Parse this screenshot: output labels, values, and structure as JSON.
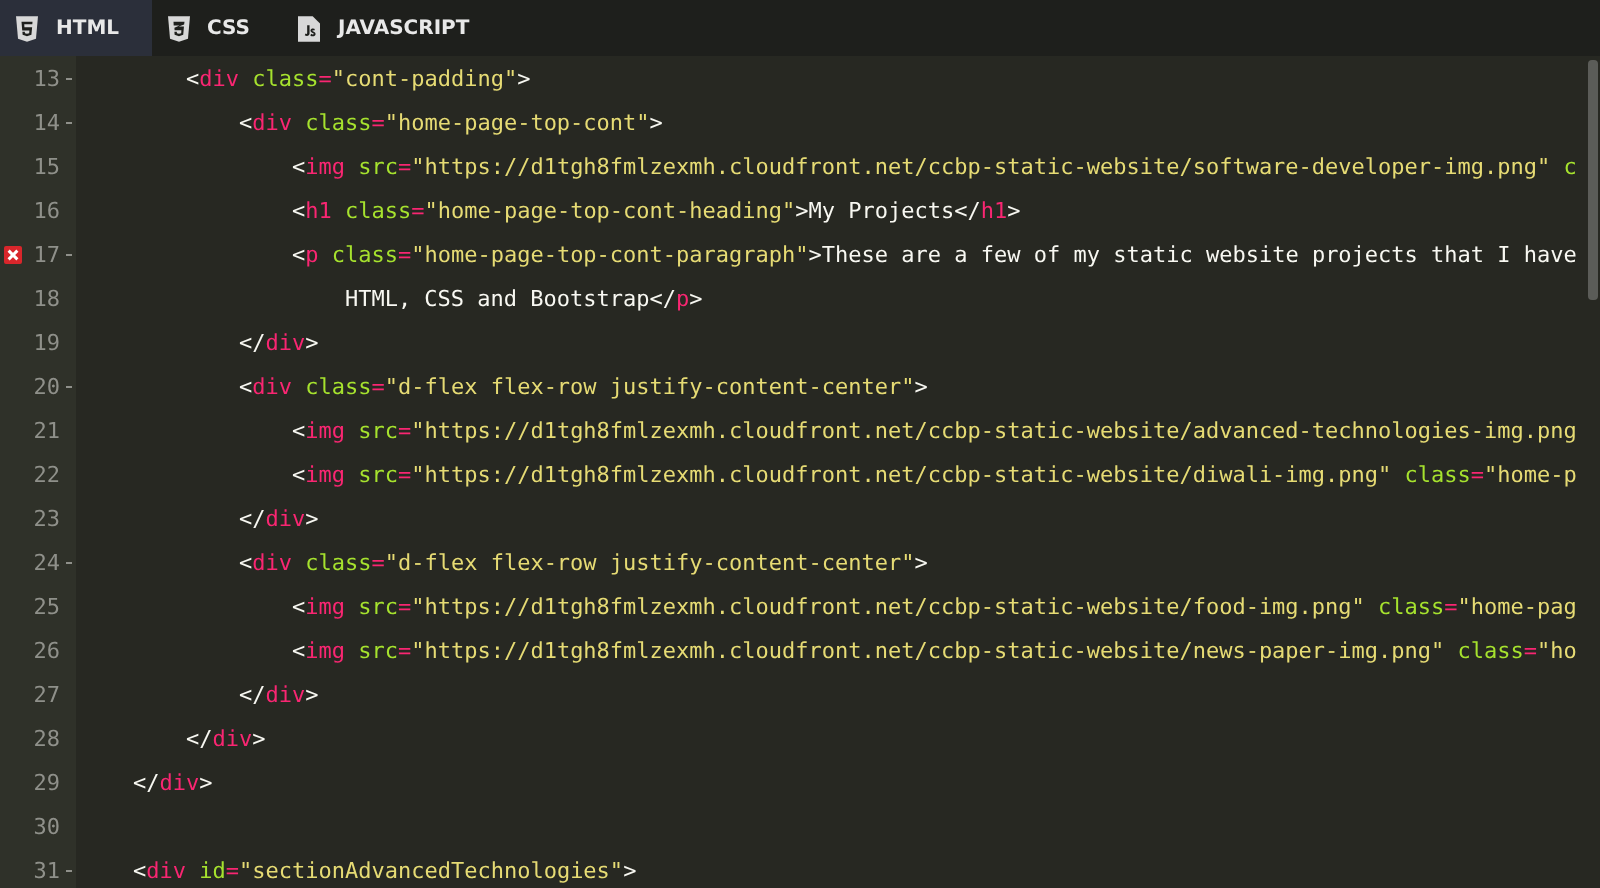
{
  "tabs": [
    {
      "label": "HTML",
      "selected": true
    },
    {
      "label": "CSS",
      "selected": false
    },
    {
      "label": "JAVASCRIPT",
      "selected": false
    }
  ],
  "lines": [
    {
      "number": "13",
      "fold": true,
      "error": false,
      "tokens": [
        {
          "kind": "punct",
          "text": "        <"
        },
        {
          "kind": "tag",
          "text": "div"
        },
        {
          "kind": "attr",
          "text": " class"
        },
        {
          "kind": "op",
          "text": "="
        },
        {
          "kind": "str",
          "text": "\"cont-padding\""
        },
        {
          "kind": "punct",
          "text": ">"
        }
      ]
    },
    {
      "number": "14",
      "fold": true,
      "error": false,
      "tokens": [
        {
          "kind": "punct",
          "text": "            <"
        },
        {
          "kind": "tag",
          "text": "div"
        },
        {
          "kind": "attr",
          "text": " class"
        },
        {
          "kind": "op",
          "text": "="
        },
        {
          "kind": "str",
          "text": "\"home-page-top-cont\""
        },
        {
          "kind": "punct",
          "text": ">"
        }
      ]
    },
    {
      "number": "15",
      "fold": false,
      "error": false,
      "tokens": [
        {
          "kind": "punct",
          "text": "                <"
        },
        {
          "kind": "tag",
          "text": "img"
        },
        {
          "kind": "attr",
          "text": " src"
        },
        {
          "kind": "op",
          "text": "="
        },
        {
          "kind": "str",
          "text": "\"https://d1tgh8fmlzexmh.cloudfront.net/ccbp-static-website/software-developer-img.png\""
        },
        {
          "kind": "attr",
          "text": " c"
        }
      ]
    },
    {
      "number": "16",
      "fold": false,
      "error": false,
      "tokens": [
        {
          "kind": "punct",
          "text": "                <"
        },
        {
          "kind": "tag",
          "text": "h1"
        },
        {
          "kind": "attr",
          "text": " class"
        },
        {
          "kind": "op",
          "text": "="
        },
        {
          "kind": "str",
          "text": "\"home-page-top-cont-heading\""
        },
        {
          "kind": "punct",
          "text": ">"
        },
        {
          "kind": "text",
          "text": "My Projects"
        },
        {
          "kind": "punct",
          "text": "</"
        },
        {
          "kind": "tag",
          "text": "h1"
        },
        {
          "kind": "punct",
          "text": ">"
        }
      ]
    },
    {
      "number": "17",
      "fold": true,
      "error": true,
      "tokens": [
        {
          "kind": "punct",
          "text": "                <"
        },
        {
          "kind": "tag",
          "text": "p"
        },
        {
          "kind": "attr",
          "text": " class"
        },
        {
          "kind": "op",
          "text": "="
        },
        {
          "kind": "str",
          "text": "\"home-page-top-cont-paragraph\""
        },
        {
          "kind": "punct",
          "text": ">"
        },
        {
          "kind": "text",
          "text": "These are a few of my static website projects that I have"
        }
      ]
    },
    {
      "number": "18",
      "fold": false,
      "error": false,
      "tokens": [
        {
          "kind": "text",
          "text": "                    HTML, CSS and Bootstrap"
        },
        {
          "kind": "punct",
          "text": "</"
        },
        {
          "kind": "tag",
          "text": "p"
        },
        {
          "kind": "punct",
          "text": ">"
        }
      ]
    },
    {
      "number": "19",
      "fold": false,
      "error": false,
      "tokens": [
        {
          "kind": "punct",
          "text": "            </"
        },
        {
          "kind": "tag",
          "text": "div"
        },
        {
          "kind": "punct",
          "text": ">"
        }
      ]
    },
    {
      "number": "20",
      "fold": true,
      "error": false,
      "tokens": [
        {
          "kind": "punct",
          "text": "            <"
        },
        {
          "kind": "tag",
          "text": "div"
        },
        {
          "kind": "attr",
          "text": " class"
        },
        {
          "kind": "op",
          "text": "="
        },
        {
          "kind": "str",
          "text": "\"d-flex flex-row justify-content-center\""
        },
        {
          "kind": "punct",
          "text": ">"
        }
      ]
    },
    {
      "number": "21",
      "fold": false,
      "error": false,
      "tokens": [
        {
          "kind": "punct",
          "text": "                <"
        },
        {
          "kind": "tag",
          "text": "img"
        },
        {
          "kind": "attr",
          "text": " src"
        },
        {
          "kind": "op",
          "text": "="
        },
        {
          "kind": "str",
          "text": "\"https://d1tgh8fmlzexmh.cloudfront.net/ccbp-static-website/advanced-technologies-img.png"
        }
      ]
    },
    {
      "number": "22",
      "fold": false,
      "error": false,
      "tokens": [
        {
          "kind": "punct",
          "text": "                <"
        },
        {
          "kind": "tag",
          "text": "img"
        },
        {
          "kind": "attr",
          "text": " src"
        },
        {
          "kind": "op",
          "text": "="
        },
        {
          "kind": "str",
          "text": "\"https://d1tgh8fmlzexmh.cloudfront.net/ccbp-static-website/diwali-img.png\""
        },
        {
          "kind": "attr",
          "text": " class"
        },
        {
          "kind": "op",
          "text": "="
        },
        {
          "kind": "str",
          "text": "\"home-p"
        }
      ]
    },
    {
      "number": "23",
      "fold": false,
      "error": false,
      "tokens": [
        {
          "kind": "punct",
          "text": "            </"
        },
        {
          "kind": "tag",
          "text": "div"
        },
        {
          "kind": "punct",
          "text": ">"
        }
      ]
    },
    {
      "number": "24",
      "fold": true,
      "error": false,
      "tokens": [
        {
          "kind": "punct",
          "text": "            <"
        },
        {
          "kind": "tag",
          "text": "div"
        },
        {
          "kind": "attr",
          "text": " class"
        },
        {
          "kind": "op",
          "text": "="
        },
        {
          "kind": "str",
          "text": "\"d-flex flex-row justify-content-center\""
        },
        {
          "kind": "punct",
          "text": ">"
        }
      ]
    },
    {
      "number": "25",
      "fold": false,
      "error": false,
      "tokens": [
        {
          "kind": "punct",
          "text": "                <"
        },
        {
          "kind": "tag",
          "text": "img"
        },
        {
          "kind": "attr",
          "text": " src"
        },
        {
          "kind": "op",
          "text": "="
        },
        {
          "kind": "str",
          "text": "\"https://d1tgh8fmlzexmh.cloudfront.net/ccbp-static-website/food-img.png\""
        },
        {
          "kind": "attr",
          "text": " class"
        },
        {
          "kind": "op",
          "text": "="
        },
        {
          "kind": "str",
          "text": "\"home-pag"
        }
      ]
    },
    {
      "number": "26",
      "fold": false,
      "error": false,
      "tokens": [
        {
          "kind": "punct",
          "text": "                <"
        },
        {
          "kind": "tag",
          "text": "img"
        },
        {
          "kind": "attr",
          "text": " src"
        },
        {
          "kind": "op",
          "text": "="
        },
        {
          "kind": "str",
          "text": "\"https://d1tgh8fmlzexmh.cloudfront.net/ccbp-static-website/news-paper-img.png\""
        },
        {
          "kind": "attr",
          "text": " class"
        },
        {
          "kind": "op",
          "text": "="
        },
        {
          "kind": "str",
          "text": "\"ho"
        }
      ]
    },
    {
      "number": "27",
      "fold": false,
      "error": false,
      "tokens": [
        {
          "kind": "punct",
          "text": "            </"
        },
        {
          "kind": "tag",
          "text": "div"
        },
        {
          "kind": "punct",
          "text": ">"
        }
      ]
    },
    {
      "number": "28",
      "fold": false,
      "error": false,
      "tokens": [
        {
          "kind": "punct",
          "text": "        </"
        },
        {
          "kind": "tag",
          "text": "div"
        },
        {
          "kind": "punct",
          "text": ">"
        }
      ]
    },
    {
      "number": "29",
      "fold": false,
      "error": false,
      "tokens": [
        {
          "kind": "punct",
          "text": "    </"
        },
        {
          "kind": "tag",
          "text": "div"
        },
        {
          "kind": "punct",
          "text": ">"
        }
      ]
    },
    {
      "number": "30",
      "fold": false,
      "error": false
    },
    {
      "number": "31",
      "fold": true,
      "error": false,
      "tokens": [
        {
          "kind": "punct",
          "text": "    <"
        },
        {
          "kind": "tag",
          "text": "div"
        },
        {
          "kind": "attr",
          "text": " id"
        },
        {
          "kind": "op",
          "text": "="
        },
        {
          "kind": "str",
          "text": "\"sectionAdvancedTechnologies\""
        },
        {
          "kind": "punct",
          "text": ">"
        }
      ]
    }
  ]
}
